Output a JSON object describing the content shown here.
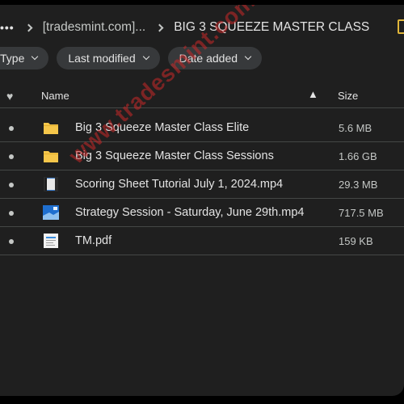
{
  "breadcrumb": {
    "more": "•••",
    "parent": "[tradesmint.com]...",
    "current": "BIG 3 SQUEEZE MASTER CLASS"
  },
  "filters": [
    {
      "label": "Type"
    },
    {
      "label": "Last modified"
    },
    {
      "label": "Date added"
    }
  ],
  "table": {
    "headers": {
      "name": "Name",
      "size": "Size",
      "sort_glyph": "▲"
    },
    "rows": [
      {
        "name": "Big 3 Squeeze Master Class Elite",
        "size": "5.6 MB",
        "icon": "folder-icon"
      },
      {
        "name": "Big 3 Squeeze Master Class Sessions",
        "size": "1.66 GB",
        "icon": "folder-icon"
      },
      {
        "name": "Scoring Sheet Tutorial July 1, 2024.mp4",
        "size": "29.3 MB",
        "icon": "video-thumbnail-icon"
      },
      {
        "name": "Strategy Session - Saturday, June 29th.mp4",
        "size": "717.5 MB",
        "icon": "video-thumbnail-icon"
      },
      {
        "name": "TM.pdf",
        "size": "159 KB",
        "icon": "pdf-thumbnail-icon"
      }
    ]
  },
  "watermark": "www.tradesmint.com",
  "colors": {
    "background": "#1f1f1f",
    "chip": "#37393b",
    "folder": "#f5c64a",
    "watermark": "#c82828"
  }
}
